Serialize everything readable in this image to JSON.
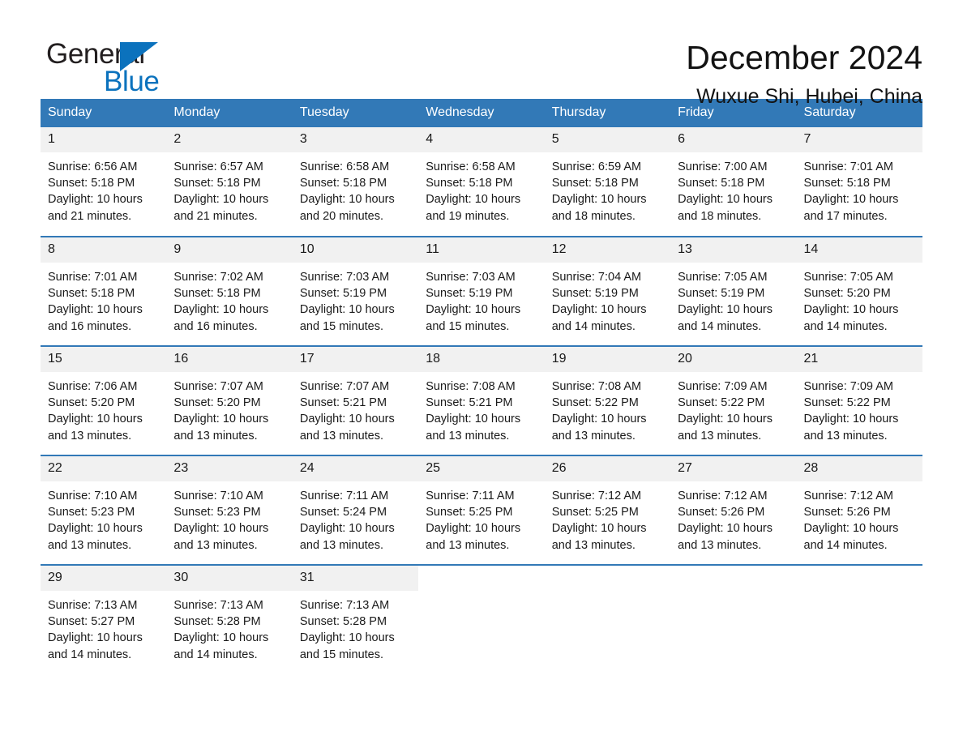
{
  "brand": {
    "name_part1": "General",
    "name_part2": "Blue",
    "logo_icon": "triangle-logo-icon"
  },
  "header": {
    "month_title": "December 2024",
    "location": "Wuxue Shi, Hubei, China"
  },
  "colors": {
    "header_blue": "#3279b7",
    "brand_blue": "#0b72bd",
    "daynum_bg": "#f1f1f1",
    "text": "#1a1a1a"
  },
  "weekdays": [
    "Sunday",
    "Monday",
    "Tuesday",
    "Wednesday",
    "Thursday",
    "Friday",
    "Saturday"
  ],
  "weeks": [
    [
      {
        "day": "1",
        "sunrise": "Sunrise: 6:56 AM",
        "sunset": "Sunset: 5:18 PM",
        "daylight_line1": "Daylight: 10 hours",
        "daylight_line2": "and 21 minutes."
      },
      {
        "day": "2",
        "sunrise": "Sunrise: 6:57 AM",
        "sunset": "Sunset: 5:18 PM",
        "daylight_line1": "Daylight: 10 hours",
        "daylight_line2": "and 21 minutes."
      },
      {
        "day": "3",
        "sunrise": "Sunrise: 6:58 AM",
        "sunset": "Sunset: 5:18 PM",
        "daylight_line1": "Daylight: 10 hours",
        "daylight_line2": "and 20 minutes."
      },
      {
        "day": "4",
        "sunrise": "Sunrise: 6:58 AM",
        "sunset": "Sunset: 5:18 PM",
        "daylight_line1": "Daylight: 10 hours",
        "daylight_line2": "and 19 minutes."
      },
      {
        "day": "5",
        "sunrise": "Sunrise: 6:59 AM",
        "sunset": "Sunset: 5:18 PM",
        "daylight_line1": "Daylight: 10 hours",
        "daylight_line2": "and 18 minutes."
      },
      {
        "day": "6",
        "sunrise": "Sunrise: 7:00 AM",
        "sunset": "Sunset: 5:18 PM",
        "daylight_line1": "Daylight: 10 hours",
        "daylight_line2": "and 18 minutes."
      },
      {
        "day": "7",
        "sunrise": "Sunrise: 7:01 AM",
        "sunset": "Sunset: 5:18 PM",
        "daylight_line1": "Daylight: 10 hours",
        "daylight_line2": "and 17 minutes."
      }
    ],
    [
      {
        "day": "8",
        "sunrise": "Sunrise: 7:01 AM",
        "sunset": "Sunset: 5:18 PM",
        "daylight_line1": "Daylight: 10 hours",
        "daylight_line2": "and 16 minutes."
      },
      {
        "day": "9",
        "sunrise": "Sunrise: 7:02 AM",
        "sunset": "Sunset: 5:18 PM",
        "daylight_line1": "Daylight: 10 hours",
        "daylight_line2": "and 16 minutes."
      },
      {
        "day": "10",
        "sunrise": "Sunrise: 7:03 AM",
        "sunset": "Sunset: 5:19 PM",
        "daylight_line1": "Daylight: 10 hours",
        "daylight_line2": "and 15 minutes."
      },
      {
        "day": "11",
        "sunrise": "Sunrise: 7:03 AM",
        "sunset": "Sunset: 5:19 PM",
        "daylight_line1": "Daylight: 10 hours",
        "daylight_line2": "and 15 minutes."
      },
      {
        "day": "12",
        "sunrise": "Sunrise: 7:04 AM",
        "sunset": "Sunset: 5:19 PM",
        "daylight_line1": "Daylight: 10 hours",
        "daylight_line2": "and 14 minutes."
      },
      {
        "day": "13",
        "sunrise": "Sunrise: 7:05 AM",
        "sunset": "Sunset: 5:19 PM",
        "daylight_line1": "Daylight: 10 hours",
        "daylight_line2": "and 14 minutes."
      },
      {
        "day": "14",
        "sunrise": "Sunrise: 7:05 AM",
        "sunset": "Sunset: 5:20 PM",
        "daylight_line1": "Daylight: 10 hours",
        "daylight_line2": "and 14 minutes."
      }
    ],
    [
      {
        "day": "15",
        "sunrise": "Sunrise: 7:06 AM",
        "sunset": "Sunset: 5:20 PM",
        "daylight_line1": "Daylight: 10 hours",
        "daylight_line2": "and 13 minutes."
      },
      {
        "day": "16",
        "sunrise": "Sunrise: 7:07 AM",
        "sunset": "Sunset: 5:20 PM",
        "daylight_line1": "Daylight: 10 hours",
        "daylight_line2": "and 13 minutes."
      },
      {
        "day": "17",
        "sunrise": "Sunrise: 7:07 AM",
        "sunset": "Sunset: 5:21 PM",
        "daylight_line1": "Daylight: 10 hours",
        "daylight_line2": "and 13 minutes."
      },
      {
        "day": "18",
        "sunrise": "Sunrise: 7:08 AM",
        "sunset": "Sunset: 5:21 PM",
        "daylight_line1": "Daylight: 10 hours",
        "daylight_line2": "and 13 minutes."
      },
      {
        "day": "19",
        "sunrise": "Sunrise: 7:08 AM",
        "sunset": "Sunset: 5:22 PM",
        "daylight_line1": "Daylight: 10 hours",
        "daylight_line2": "and 13 minutes."
      },
      {
        "day": "20",
        "sunrise": "Sunrise: 7:09 AM",
        "sunset": "Sunset: 5:22 PM",
        "daylight_line1": "Daylight: 10 hours",
        "daylight_line2": "and 13 minutes."
      },
      {
        "day": "21",
        "sunrise": "Sunrise: 7:09 AM",
        "sunset": "Sunset: 5:22 PM",
        "daylight_line1": "Daylight: 10 hours",
        "daylight_line2": "and 13 minutes."
      }
    ],
    [
      {
        "day": "22",
        "sunrise": "Sunrise: 7:10 AM",
        "sunset": "Sunset: 5:23 PM",
        "daylight_line1": "Daylight: 10 hours",
        "daylight_line2": "and 13 minutes."
      },
      {
        "day": "23",
        "sunrise": "Sunrise: 7:10 AM",
        "sunset": "Sunset: 5:23 PM",
        "daylight_line1": "Daylight: 10 hours",
        "daylight_line2": "and 13 minutes."
      },
      {
        "day": "24",
        "sunrise": "Sunrise: 7:11 AM",
        "sunset": "Sunset: 5:24 PM",
        "daylight_line1": "Daylight: 10 hours",
        "daylight_line2": "and 13 minutes."
      },
      {
        "day": "25",
        "sunrise": "Sunrise: 7:11 AM",
        "sunset": "Sunset: 5:25 PM",
        "daylight_line1": "Daylight: 10 hours",
        "daylight_line2": "and 13 minutes."
      },
      {
        "day": "26",
        "sunrise": "Sunrise: 7:12 AM",
        "sunset": "Sunset: 5:25 PM",
        "daylight_line1": "Daylight: 10 hours",
        "daylight_line2": "and 13 minutes."
      },
      {
        "day": "27",
        "sunrise": "Sunrise: 7:12 AM",
        "sunset": "Sunset: 5:26 PM",
        "daylight_line1": "Daylight: 10 hours",
        "daylight_line2": "and 13 minutes."
      },
      {
        "day": "28",
        "sunrise": "Sunrise: 7:12 AM",
        "sunset": "Sunset: 5:26 PM",
        "daylight_line1": "Daylight: 10 hours",
        "daylight_line2": "and 14 minutes."
      }
    ],
    [
      {
        "day": "29",
        "sunrise": "Sunrise: 7:13 AM",
        "sunset": "Sunset: 5:27 PM",
        "daylight_line1": "Daylight: 10 hours",
        "daylight_line2": "and 14 minutes."
      },
      {
        "day": "30",
        "sunrise": "Sunrise: 7:13 AM",
        "sunset": "Sunset: 5:28 PM",
        "daylight_line1": "Daylight: 10 hours",
        "daylight_line2": "and 14 minutes."
      },
      {
        "day": "31",
        "sunrise": "Sunrise: 7:13 AM",
        "sunset": "Sunset: 5:28 PM",
        "daylight_line1": "Daylight: 10 hours",
        "daylight_line2": "and 15 minutes."
      },
      {
        "day": "",
        "sunrise": "",
        "sunset": "",
        "daylight_line1": "",
        "daylight_line2": ""
      },
      {
        "day": "",
        "sunrise": "",
        "sunset": "",
        "daylight_line1": "",
        "daylight_line2": ""
      },
      {
        "day": "",
        "sunrise": "",
        "sunset": "",
        "daylight_line1": "",
        "daylight_line2": ""
      },
      {
        "day": "",
        "sunrise": "",
        "sunset": "",
        "daylight_line1": "",
        "daylight_line2": ""
      }
    ]
  ]
}
